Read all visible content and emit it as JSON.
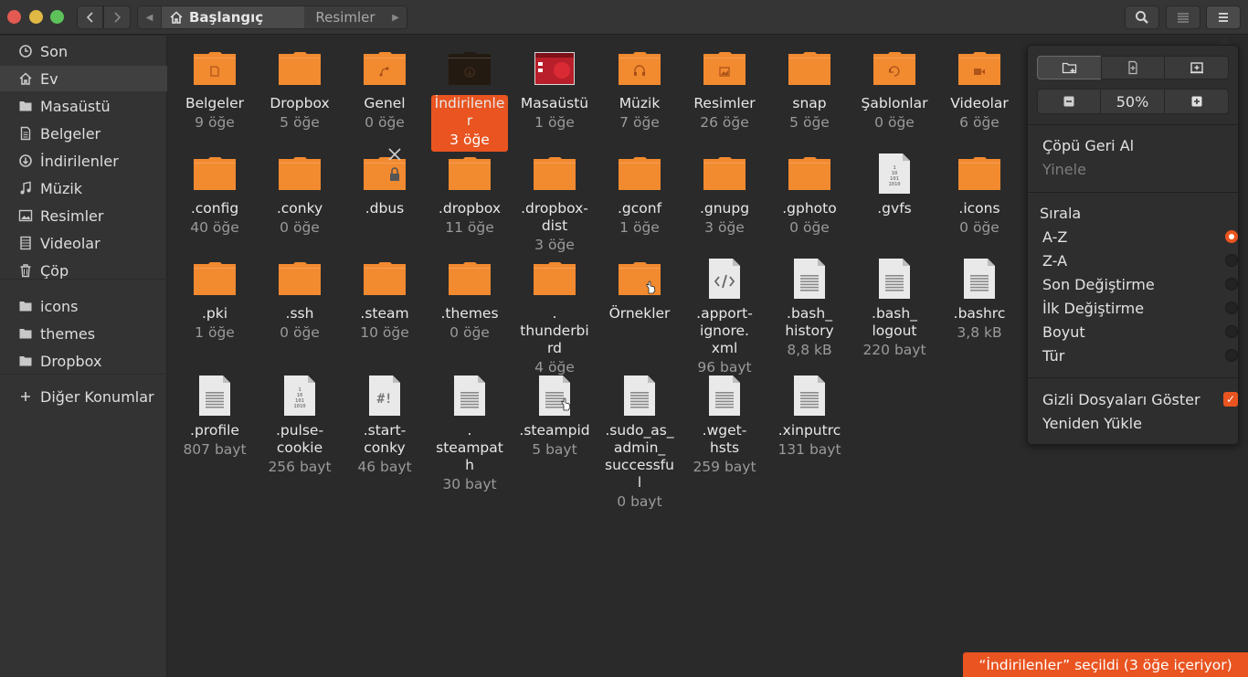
{
  "header": {
    "crumb_home": "Başlangıç",
    "crumb_pictures": "Resimler"
  },
  "sidebar": {
    "items": [
      {
        "label": "Son",
        "icon": "clock-icon"
      },
      {
        "label": "Ev",
        "icon": "home-icon"
      },
      {
        "label": "Masaüstü",
        "icon": "folder-icon"
      },
      {
        "label": "Belgeler",
        "icon": "document-icon"
      },
      {
        "label": "İndirilenler",
        "icon": "download-icon"
      },
      {
        "label": "Müzik",
        "icon": "music-icon"
      },
      {
        "label": "Resimler",
        "icon": "image-icon"
      },
      {
        "label": "Videolar",
        "icon": "film-icon"
      },
      {
        "label": "Çöp",
        "icon": "trash-icon"
      },
      {
        "label": "icons",
        "icon": "folder-icon"
      },
      {
        "label": "themes",
        "icon": "folder-icon"
      },
      {
        "label": "Dropbox",
        "icon": "folder-icon"
      },
      {
        "label": "Diğer Konumlar",
        "icon": "plus-icon"
      }
    ]
  },
  "files": [
    {
      "name": "Belgeler",
      "info": "9 öğe",
      "type": "folder",
      "emblem": "document"
    },
    {
      "name": "Dropbox",
      "info": "5 öğe",
      "type": "folder"
    },
    {
      "name": "Genel",
      "info": "0 öğe",
      "type": "folder",
      "emblem": "share"
    },
    {
      "name": "İndirilenler",
      "info": "3 öğe",
      "type": "folder-dark",
      "emblem": "download",
      "selected": true
    },
    {
      "name": "Masaüstü",
      "info": "1 öğe",
      "type": "desktop"
    },
    {
      "name": "Müzik",
      "info": "7 öğe",
      "type": "folder",
      "emblem": "music"
    },
    {
      "name": "Resimler",
      "info": "26 öğe",
      "type": "folder",
      "emblem": "image"
    },
    {
      "name": "snap",
      "info": "5 öğe",
      "type": "folder"
    },
    {
      "name": "Şablonlar",
      "info": "0 öğe",
      "type": "folder",
      "emblem": "template"
    },
    {
      "name": "Videolar",
      "info": "6 öğe",
      "type": "folder",
      "emblem": "video"
    },
    {
      "name": ".config",
      "info": "40 öğe",
      "type": "folder"
    },
    {
      "name": ".conky",
      "info": "0 öğe",
      "type": "folder"
    },
    {
      "name": ".dbus",
      "info": "",
      "type": "folder",
      "emblem": "locked"
    },
    {
      "name": ".dropbox",
      "info": "11 öğe",
      "type": "folder"
    },
    {
      "name": ".dropbox-dist",
      "info": "3 öğe",
      "type": "folder"
    },
    {
      "name": ".gconf",
      "info": "1 öğe",
      "type": "folder"
    },
    {
      "name": ".gnupg",
      "info": "3 öğe",
      "type": "folder"
    },
    {
      "name": ".gphoto",
      "info": "0 öğe",
      "type": "folder"
    },
    {
      "name": ".gvfs",
      "info": "",
      "type": "binary"
    },
    {
      "name": ".icons",
      "info": "0 öğe",
      "type": "folder"
    },
    {
      "name": ".pki",
      "info": "1 öğe",
      "type": "folder"
    },
    {
      "name": ".ssh",
      "info": "0 öğe",
      "type": "folder"
    },
    {
      "name": ".steam",
      "info": "10 öğe",
      "type": "folder"
    },
    {
      "name": ".themes",
      "info": "0 öğe",
      "type": "folder"
    },
    {
      "name": ".thunderbird",
      "info": "4 öğe",
      "type": "folder"
    },
    {
      "name": "Örnekler",
      "info": "",
      "type": "folder",
      "emblem": "link"
    },
    {
      "name": ".apport-ignore.xml",
      "info": "96 bayt",
      "type": "code"
    },
    {
      "name": ".bash_history",
      "info": "8,8 kB",
      "type": "text"
    },
    {
      "name": ".bash_logout",
      "info": "220 bayt",
      "type": "text"
    },
    {
      "name": ".bashrc",
      "info": "3,8 kB",
      "type": "text"
    },
    {
      "name": ".profile",
      "info": "807 bayt",
      "type": "text"
    },
    {
      "name": ".pulse-cookie",
      "info": "256 bayt",
      "type": "binary"
    },
    {
      "name": ".start-conky",
      "info": "46 bayt",
      "type": "script"
    },
    {
      "name": ".steampath",
      "info": "30 bayt",
      "type": "text"
    },
    {
      "name": ".steampid",
      "info": "5 bayt",
      "type": "text",
      "emblem": "link"
    },
    {
      "name": ".sudo_as_admin_successful",
      "info": "0 bayt",
      "type": "text"
    },
    {
      "name": ".wget-hsts",
      "info": "259 bayt",
      "type": "text"
    },
    {
      "name": ".xinputrc",
      "info": "131 bayt",
      "type": "text"
    }
  ],
  "menu": {
    "zoom_level": "50%",
    "undo_trash": "Çöpü Geri Al",
    "redo": "Yinele",
    "sort_title": "Sırala",
    "sort_options": [
      {
        "label": "A-Z",
        "checked": true
      },
      {
        "label": "Z-A",
        "checked": false
      },
      {
        "label": "Son Değiştirme",
        "checked": false
      },
      {
        "label": "İlk Değiştirme",
        "checked": false
      },
      {
        "label": "Boyut",
        "checked": false
      },
      {
        "label": "Tür",
        "checked": false
      }
    ],
    "show_hidden": "Gizli Dosyaları Göster",
    "show_hidden_checked": true,
    "reload": "Yeniden Yükle"
  },
  "status": "“İndirilenler” seçildi (3 öğe içeriyor)",
  "colors": {
    "accent": "#e95420",
    "folder": "#f28a30"
  }
}
